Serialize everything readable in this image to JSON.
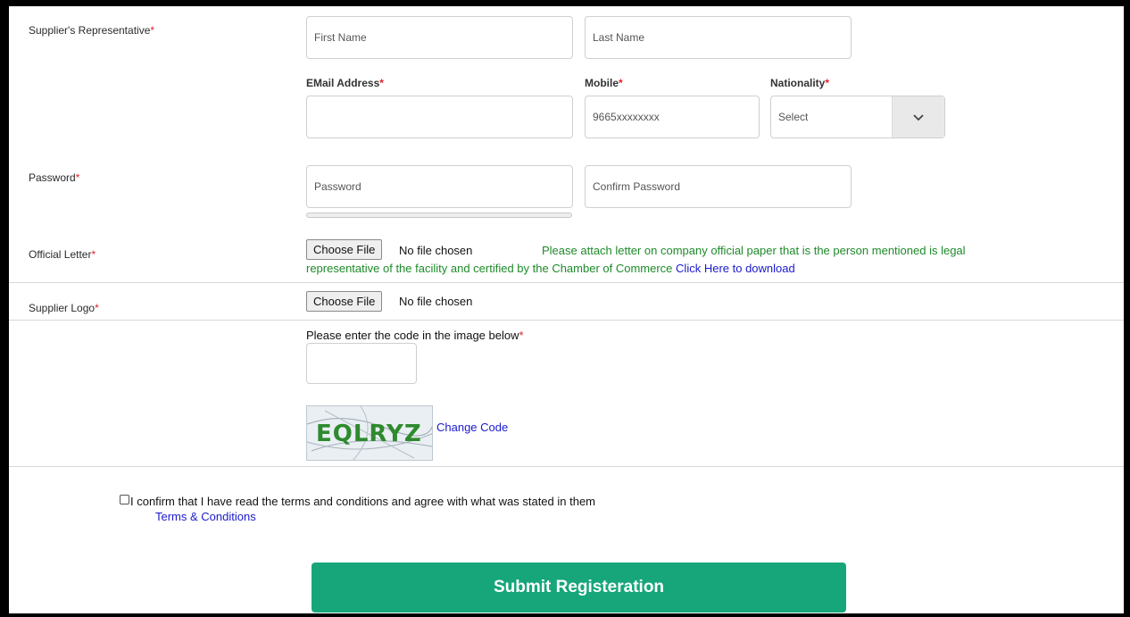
{
  "representative": {
    "label": "Supplier's Representative",
    "first_name_placeholder": "First Name",
    "last_name_placeholder": "Last Name",
    "email_label": "EMail Address",
    "mobile_label": "Mobile",
    "mobile_placeholder": "9665xxxxxxxx",
    "nationality_label": "Nationality",
    "nationality_value": "Select"
  },
  "password": {
    "label": "Password",
    "password_placeholder": "Password",
    "confirm_placeholder": "Confirm Password"
  },
  "official_letter": {
    "label": "Official Letter",
    "button": "Choose File",
    "status": "No file chosen",
    "note_line1": "Please attach letter on company official paper that is the person mentioned is legal",
    "note_line2": "representative of the facility and certified by the Chamber of Commerce",
    "download_link": "Click Here to download"
  },
  "supplier_logo": {
    "label": "Supplier Logo",
    "button": "Choose File",
    "status": "No file chosen"
  },
  "captcha": {
    "prompt": "Please enter the code in the image below",
    "image_text": "EQLRYZ",
    "change_link": "Change Code"
  },
  "terms": {
    "confirm_text": "I confirm that I have read the terms and conditions and agree with what was stated in them",
    "link": "Terms & Conditions",
    "checked": false
  },
  "submit_label": "Submit Registeration",
  "colors": {
    "required": "#e0202a",
    "note_green": "#1e8a2a",
    "link_blue": "#1a1acc",
    "submit_bg": "#16a67a"
  },
  "required_mark": "*"
}
